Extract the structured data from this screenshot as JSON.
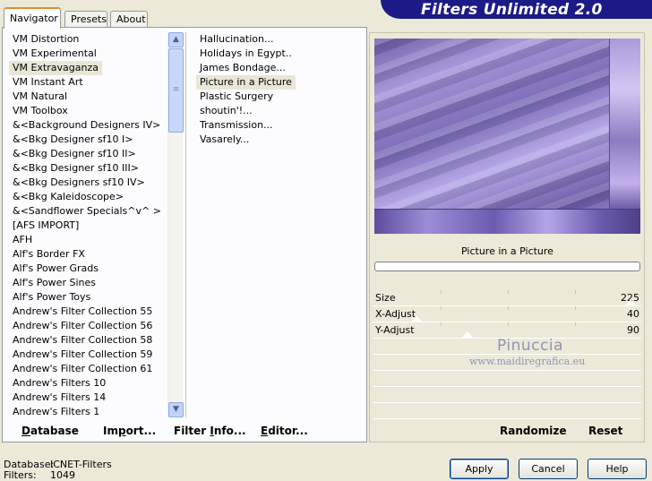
{
  "header": {
    "title": "Filters Unlimited 2.0"
  },
  "tabs": [
    {
      "label": "Navigator",
      "active": true
    },
    {
      "label": "Presets",
      "active": false
    },
    {
      "label": "About",
      "active": false
    }
  ],
  "categories": [
    "VM Distortion",
    "VM Experimental",
    "VM Extravaganza",
    "VM Instant Art",
    "VM Natural",
    "VM Toolbox",
    "&<Background Designers IV>",
    "&<Bkg Designer sf10 I>",
    "&<Bkg Designer sf10 II>",
    "&<Bkg Designer sf10 III>",
    "&<Bkg Designers sf10 IV>",
    "&<Bkg Kaleidoscope>",
    "&<Sandflower Specials^v^ >",
    "[AFS IMPORT]",
    "AFH",
    "Alf's Border FX",
    "Alf's Power Grads",
    "Alf's Power Sines",
    "Alf's Power Toys",
    "Andrew's Filter Collection 55",
    "Andrew's Filter Collection 56",
    "Andrew's Filter Collection 58",
    "Andrew's Filter Collection 59",
    "Andrew's Filter Collection 61",
    "Andrew's Filters 10",
    "Andrew's Filters 14",
    "Andrew's Filters 1"
  ],
  "selected_category": "VM Extravaganza",
  "filters": [
    "Hallucination...",
    "Holidays in Egypt..",
    "James Bondage...",
    "Picture in a Picture",
    "Plastic Surgery",
    "shoutin'!...",
    "Transmission...",
    "Vasarely..."
  ],
  "selected_filter": "Picture in a Picture",
  "left_toolbar": {
    "database_u": "D",
    "database_rest": "atabase",
    "import_a": "Im",
    "import_u": "p",
    "import_b": "ort...",
    "info_a": "Filter ",
    "info_u": "I",
    "info_b": "nfo...",
    "editor_u": "E",
    "editor_rest": "ditor..."
  },
  "preview": {
    "filter_name": "Picture in a Picture"
  },
  "params": [
    {
      "label": "Size",
      "value": "225"
    },
    {
      "label": "X-Adjust",
      "value": "40"
    },
    {
      "label": "Y-Adjust",
      "value": "90"
    }
  ],
  "watermark": {
    "line1": "Pinuccia",
    "line2": "www.maidiregrafica.eu"
  },
  "right_toolbar": {
    "randomize": "Randomize",
    "reset": "Reset"
  },
  "status": {
    "database_label": "Database:",
    "database_value": "ICNET-Filters",
    "filters_label": "Filters:",
    "filters_value": "1049"
  },
  "dialog_buttons": {
    "apply": "Apply",
    "cancel": "Cancel",
    "help": "Help"
  },
  "colors": {
    "banner": "#1c1a86",
    "tab_accent": "#e68b2c",
    "preview_base": "#8c7cc1"
  }
}
